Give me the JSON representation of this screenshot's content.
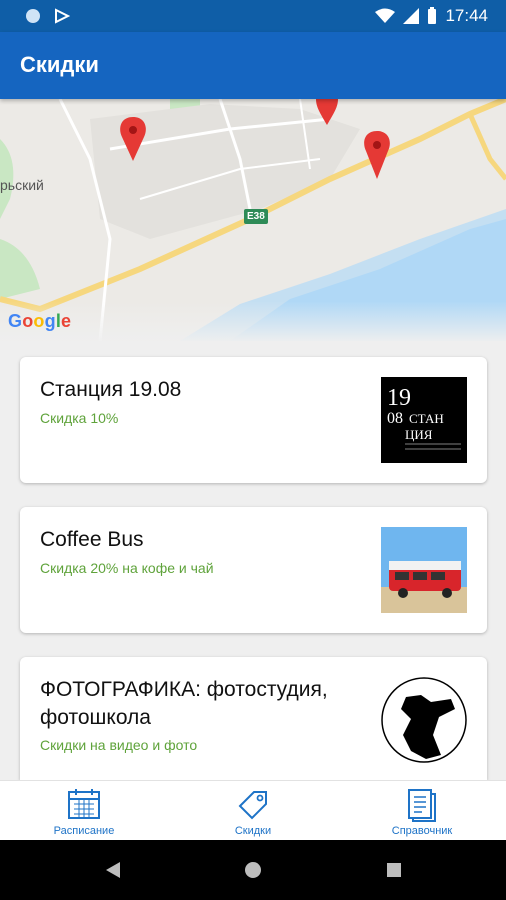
{
  "status_bar": {
    "time": "17:44"
  },
  "app_bar": {
    "title": "Скидки"
  },
  "map": {
    "place_label": "рьский",
    "road_badge": "E38",
    "logo": "Google"
  },
  "cards": [
    {
      "title": "Станция 19.08",
      "subtitle": "Скидка 10%",
      "logo_text_lines": [
        "19",
        "08",
        "СТАН",
        "ЦИЯ"
      ]
    },
    {
      "title": "Coffee Bus",
      "subtitle": "Скидка 20% на кофе и чай"
    },
    {
      "title": "ФОТОГРАФИКА: фотостудия, фотошкола",
      "subtitle": "Скидки на видео и фото"
    }
  ],
  "bottom_nav": [
    {
      "label": "Расписание",
      "icon": "calendar-icon"
    },
    {
      "label": "Скидки",
      "icon": "tag-icon"
    },
    {
      "label": "Справочник",
      "icon": "document-icon"
    }
  ],
  "colors": {
    "primary": "#1565c0",
    "status_bar": "#0f5ea7",
    "accent_green": "#5fa33b",
    "nav_blue": "#1e73c7"
  }
}
